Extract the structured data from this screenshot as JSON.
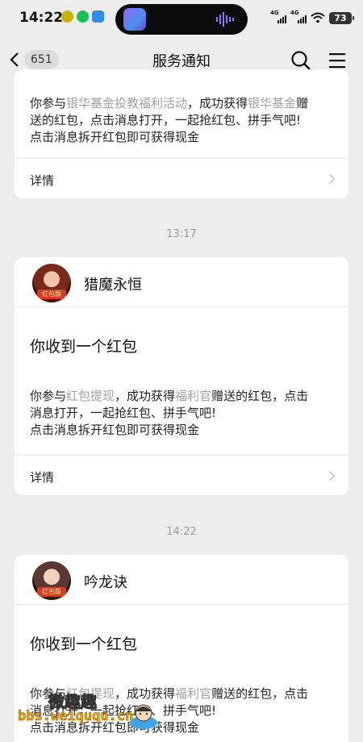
{
  "status_bar": {
    "time": "14:22",
    "signal1": "4G",
    "signal2": "4G",
    "battery": "73"
  },
  "nav": {
    "back_count": "651",
    "title": "服务通知"
  },
  "cards": [
    {
      "body_lines": [
        {
          "parts": [
            {
              "t": "你参与",
              "hl": false
            },
            {
              "t": "银华基金投教福利活动",
              "hl": true
            },
            {
              "t": "，成功获得",
              "hl": false
            },
            {
              "t": "银华基金",
              "hl": true
            },
            {
              "t": "赠",
              "hl": false
            }
          ]
        },
        {
          "parts": [
            {
              "t": "送的红包，点击消息打开，一起抢红包、拼手气吧!",
              "hl": false
            }
          ]
        },
        {
          "parts": [
            {
              "t": "点击消息拆开红包即可获得现金",
              "hl": false
            }
          ]
        }
      ],
      "detail_label": "详情"
    },
    {
      "timestamp": "13:17",
      "sender": "猎魔永恒",
      "avatar_tag": "红包版",
      "title": "你收到一个红包",
      "body_lines": [
        {
          "parts": [
            {
              "t": "你参与",
              "hl": false
            },
            {
              "t": "红包提现",
              "hl": true
            },
            {
              "t": "，成功获得",
              "hl": false
            },
            {
              "t": "福利官",
              "hl": true
            },
            {
              "t": "赠送的红包，点击",
              "hl": false
            }
          ]
        },
        {
          "parts": [
            {
              "t": "消息打开，一起抢红包、拼手气吧!",
              "hl": false
            }
          ]
        },
        {
          "parts": [
            {
              "t": "点击消息拆开红包即可获得现金",
              "hl": false
            }
          ]
        }
      ],
      "detail_label": "详情"
    },
    {
      "timestamp": "14:22",
      "sender": "吟龙诀",
      "avatar_tag": "红包版",
      "title": "你收到一个红包",
      "body_lines": [
        {
          "parts": [
            {
              "t": "你参与",
              "hl": false
            },
            {
              "t": "红包提现",
              "hl": true
            },
            {
              "t": "，成功获得",
              "hl": false
            },
            {
              "t": "福利官",
              "hl": true
            },
            {
              "t": "赠送的红包，点击",
              "hl": false
            }
          ]
        },
        {
          "parts": [
            {
              "t": "消息打开，一起抢红包、拼手气吧!",
              "hl": false
            }
          ]
        },
        {
          "parts": [
            {
              "t": "点击消息拆开红包即可获得现金",
              "hl": false
            }
          ]
        }
      ]
    }
  ],
  "watermark": {
    "top": "微趣趣",
    "url": "bbs.weiququ.cn"
  },
  "colors": {
    "background": "#ededed",
    "card": "#ffffff",
    "highlight_text": "#a3a3a3",
    "timestamp_text": "#9a9a9a"
  }
}
